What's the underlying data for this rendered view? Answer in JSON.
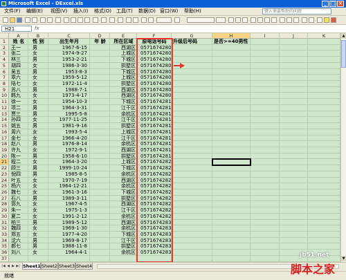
{
  "window": {
    "title": "Microsoft Excel - DExcel.xls",
    "controls": [
      "_",
      "□",
      "×"
    ]
  },
  "menus": [
    "文件(F)",
    "编辑(E)",
    "视图(V)",
    "插入(I)",
    "格式(O)",
    "工具(T)",
    "数据(D)",
    "窗口(W)",
    "帮助(H)"
  ],
  "help_placeholder": "键入需要帮助的问题",
  "formula_bar": {
    "name_box": "H21",
    "fx": "fx",
    "value": ""
  },
  "columns": [
    "A",
    "B",
    "C",
    "D",
    "E",
    "F",
    "G",
    "H",
    "I",
    "J",
    "K"
  ],
  "selected_column": "H",
  "selected_row": 21,
  "headers": {
    "A": "姓 名",
    "B": "性 别",
    "C": "出生年月",
    "D": "年 龄",
    "E": "所在区域",
    "F": "原电话号码",
    "G": "升级后号码",
    "H": "是否>=40男性"
  },
  "rows": [
    {
      "r": 2,
      "a": "王一",
      "b": "男",
      "c": "1967-6-15",
      "e": "西湖区",
      "f": "05716742801"
    },
    {
      "r": 3,
      "a": "张二",
      "b": "女",
      "c": "1974-9-27",
      "e": "上城区",
      "f": "05716742802"
    },
    {
      "r": 4,
      "a": "林三",
      "b": "男",
      "c": "1953-2-21",
      "e": "下城区",
      "f": "05716742803"
    },
    {
      "r": 5,
      "a": "胡四",
      "b": "女",
      "c": "1986-3-30",
      "e": "拱墅区",
      "f": "05716742804"
    },
    {
      "r": 6,
      "a": "吴五",
      "b": "男",
      "c": "1953-8-3",
      "e": "下城区",
      "f": "05716742805"
    },
    {
      "r": 7,
      "a": "章六",
      "b": "女",
      "c": "1959-5-12",
      "e": "上城区",
      "f": "05716742806"
    },
    {
      "r": 8,
      "a": "陆七",
      "b": "女",
      "c": "1972-11-4",
      "e": "拱墅区",
      "f": "05716742807"
    },
    {
      "r": 9,
      "a": "苏八",
      "b": "男",
      "c": "1988-7-1",
      "e": "西湖区",
      "f": "05716742808"
    },
    {
      "r": 10,
      "a": "韩九",
      "b": "女",
      "c": "1973-4-17",
      "e": "西湖区",
      "f": "05716742809"
    },
    {
      "r": 11,
      "a": "徐一",
      "b": "女",
      "c": "1954-10-3",
      "e": "下城区",
      "f": "05716742810"
    },
    {
      "r": 12,
      "a": "项二",
      "b": "男",
      "c": "1964-3-31",
      "e": "江干区",
      "f": "05716742811"
    },
    {
      "r": 13,
      "a": "贾三",
      "b": "男",
      "c": "1995-5-8",
      "e": "余杭区",
      "f": "05716742812"
    },
    {
      "r": 14,
      "a": "孙四",
      "b": "女",
      "c": "1977-11-25",
      "e": "江干区",
      "f": "05716742813"
    },
    {
      "r": 15,
      "a": "姚五",
      "b": "男",
      "c": "1981-9-16",
      "e": "拱墅区",
      "f": "05716742814"
    },
    {
      "r": 16,
      "a": "周六",
      "b": "女",
      "c": "1993-5-4",
      "e": "上城区",
      "f": "05716742815"
    },
    {
      "r": 17,
      "a": "金七",
      "b": "女",
      "c": "1966-4-20",
      "e": "江干区",
      "f": "05716742816"
    },
    {
      "r": 18,
      "a": "赵八",
      "b": "男",
      "c": "1976-8-14",
      "e": "余杭区",
      "f": "05716742817"
    },
    {
      "r": 19,
      "a": "许九",
      "b": "女",
      "c": "1972-9-1",
      "e": "西湖区",
      "f": "05716742818"
    },
    {
      "r": 20,
      "a": "陈一",
      "b": "男",
      "c": "1958-6-10",
      "e": "拱墅区",
      "f": "05716742819"
    },
    {
      "r": 21,
      "a": "程二",
      "b": "女",
      "c": "1964-3-20",
      "e": "上城区",
      "f": "05716742820"
    },
    {
      "r": 22,
      "a": "顾三",
      "b": "男",
      "c": "1999-10-24",
      "e": "下城区",
      "f": "05716742821"
    },
    {
      "r": 23,
      "a": "倪四",
      "b": "男",
      "c": "1985-8-5",
      "e": "余杭区",
      "f": "05716742822"
    },
    {
      "r": 24,
      "a": "叶五",
      "b": "女",
      "c": "1970-7-19",
      "e": "西湖区",
      "f": "05716742823"
    },
    {
      "r": 25,
      "a": "杨六",
      "b": "女",
      "c": "1964-12-21",
      "e": "余杭区",
      "f": "05716742824"
    },
    {
      "r": 26,
      "a": "魏七",
      "b": "女",
      "c": "1961-3-16",
      "e": "下城区",
      "f": "05716742825"
    },
    {
      "r": 27,
      "a": "石八",
      "b": "男",
      "c": "1989-3-11",
      "e": "拱墅区",
      "f": "05716742826"
    },
    {
      "r": 28,
      "a": "郭九",
      "b": "女",
      "c": "1967-4-5",
      "e": "西湖区",
      "f": "05716742827"
    },
    {
      "r": 29,
      "a": "朱一",
      "b": "女",
      "c": "1975-1-3",
      "e": "江干区",
      "f": "05716742828"
    },
    {
      "r": 30,
      "a": "夏二",
      "b": "女",
      "c": "1991-2-12",
      "e": "余杭区",
      "f": "05716742829"
    },
    {
      "r": 31,
      "a": "柏三",
      "b": "男",
      "c": "1989-5-12",
      "e": "西湖区",
      "f": "05716742830"
    },
    {
      "r": 32,
      "a": "魏四",
      "b": "女",
      "c": "1969-1-30",
      "e": "余杭区",
      "f": "05716742831"
    },
    {
      "r": 33,
      "a": "郑五",
      "b": "女",
      "c": "1977-4-20",
      "e": "下城区",
      "f": "05716742832"
    },
    {
      "r": 34,
      "a": "沈六",
      "b": "男",
      "c": "1969-8-17",
      "e": "江干区",
      "f": "05716742833"
    },
    {
      "r": 35,
      "a": "郝七",
      "b": "男",
      "c": "1988-11-8",
      "e": "拱墅区",
      "f": "05716742834"
    },
    {
      "r": 36,
      "a": "刘八",
      "b": "女",
      "c": "1964-4-1",
      "e": "余杭区",
      "f": "05716742835"
    }
  ],
  "sheet_tabs": [
    "Sheet1",
    "Sheet2",
    "Sheet3",
    "Sheet4"
  ],
  "active_sheet": "Sheet1",
  "status_text": "就绪",
  "watermark": {
    "line1": "jb51.net",
    "line2": "脚本之家"
  },
  "colors": {
    "title_bar": "#0a5fd8",
    "sheet_background": "#cfe8cc",
    "highlight_border": "#e8342c"
  }
}
